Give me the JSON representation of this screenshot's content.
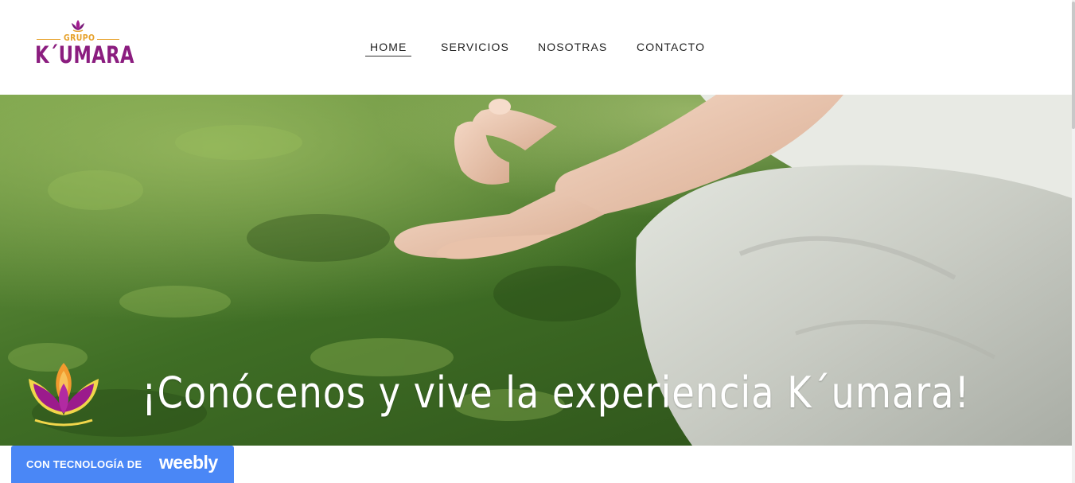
{
  "logo": {
    "small": "GRUPO",
    "main": "K´UMARA"
  },
  "nav": {
    "items": [
      {
        "label": "HOME",
        "active": true
      },
      {
        "label": "SERVICIOS",
        "active": false
      },
      {
        "label": "NOSOTRAS",
        "active": false
      },
      {
        "label": "CONTACTO",
        "active": false
      }
    ]
  },
  "hero": {
    "tagline": "¡Conócenos y vive la experiencia K´umara!"
  },
  "badge": {
    "prefix": "CON TECNOLOGÍA DE",
    "brand": "weebly"
  },
  "colors": {
    "brand_purple": "#8b1d7f",
    "brand_gold": "#e6a12a",
    "badge_blue": "#4a87f6"
  }
}
